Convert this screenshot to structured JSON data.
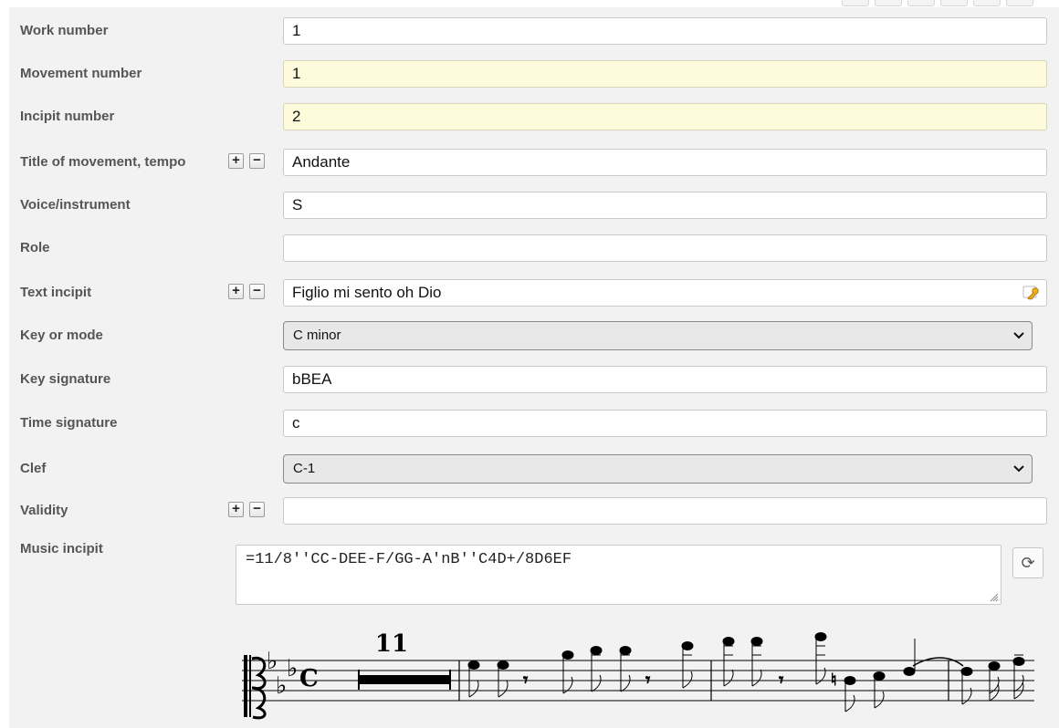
{
  "form": {
    "work_number": {
      "label": "Work number",
      "value": "1"
    },
    "movement_number": {
      "label": "Movement number",
      "value": "1"
    },
    "incipit_number": {
      "label": "Incipit number",
      "value": "2"
    },
    "title_tempo": {
      "label": "Title of movement, tempo",
      "value": "Andante"
    },
    "voice_instrument": {
      "label": "Voice/instrument",
      "value": "S"
    },
    "role": {
      "label": "Role",
      "value": ""
    },
    "text_incipit": {
      "label": "Text incipit",
      "value": "Figlio mi sento oh Dio"
    },
    "key_mode": {
      "label": "Key or mode",
      "selected": "C minor"
    },
    "key_signature": {
      "label": "Key signature",
      "value": "bBEA"
    },
    "time_signature": {
      "label": "Time signature",
      "value": "c"
    },
    "clef": {
      "label": "Clef",
      "selected": "C-1"
    },
    "validity": {
      "label": "Validity",
      "value": ""
    },
    "music_incipit": {
      "label": "Music incipit",
      "value": "=11/8''CC-DEE-F/GG-A'nB''C4D+/8D6EF"
    }
  },
  "buttons": {
    "plus": "+",
    "minus": "−",
    "select_chevron": "❯",
    "refresh": "⟳"
  },
  "notation": {
    "rest_count": "11",
    "time_symbol": "C"
  },
  "colors": {
    "panel": "#f2f2f2",
    "readonly_field": "#fefbdc",
    "select_bg": "#e8e8e8"
  }
}
